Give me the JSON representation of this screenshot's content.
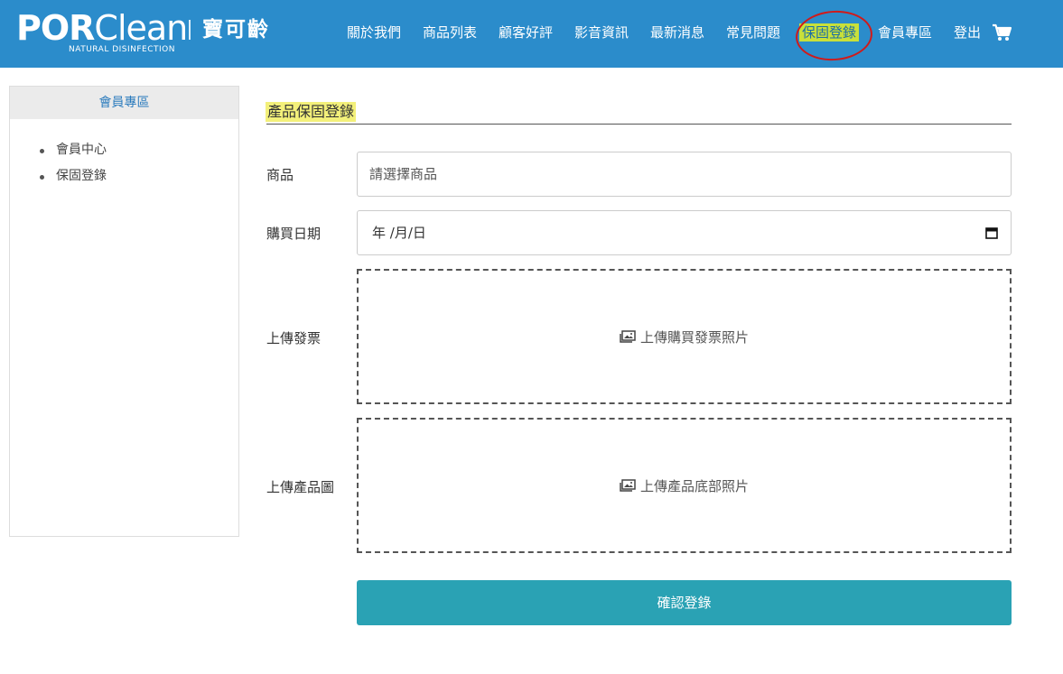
{
  "brand": {
    "name_bold": "POR",
    "name_light": "Clean",
    "tagline": "NATURAL DISINFECTION",
    "chinese": "寶可齡"
  },
  "nav": {
    "items": [
      {
        "label": "關於我們"
      },
      {
        "label": "商品列表"
      },
      {
        "label": "顧客好評"
      },
      {
        "label": "影音資訊"
      },
      {
        "label": "最新消息"
      },
      {
        "label": "常見問題"
      },
      {
        "label": "保固登錄",
        "active": true
      },
      {
        "label": "會員專區"
      },
      {
        "label": "登出"
      }
    ],
    "cart_icon": "cart-icon"
  },
  "sidebar": {
    "title": "會員專區",
    "items": [
      {
        "label": "會員中心"
      },
      {
        "label": "保固登錄"
      }
    ]
  },
  "main": {
    "title": "產品保固登錄",
    "fields": {
      "product": {
        "label": "商品",
        "placeholder": "請選擇商品"
      },
      "purchase_date": {
        "label": "購買日期",
        "value": "年 /月/日",
        "icon": "calendar-icon"
      },
      "invoice": {
        "label": "上傳發票",
        "button_text": "上傳購買發票照片",
        "icon": "image-icon"
      },
      "product_image": {
        "label": "上傳產品圖",
        "button_text": "上傳產品底部照片",
        "icon": "image-icon"
      }
    },
    "submit_label": "確認登錄"
  },
  "colors": {
    "header_bg": "#2b8ccb",
    "submit_bg": "#2aa2b4",
    "highlight": "#f3f07a",
    "active_nav_bg": "#c8e03a",
    "annotation_circle": "#d01a1a"
  }
}
